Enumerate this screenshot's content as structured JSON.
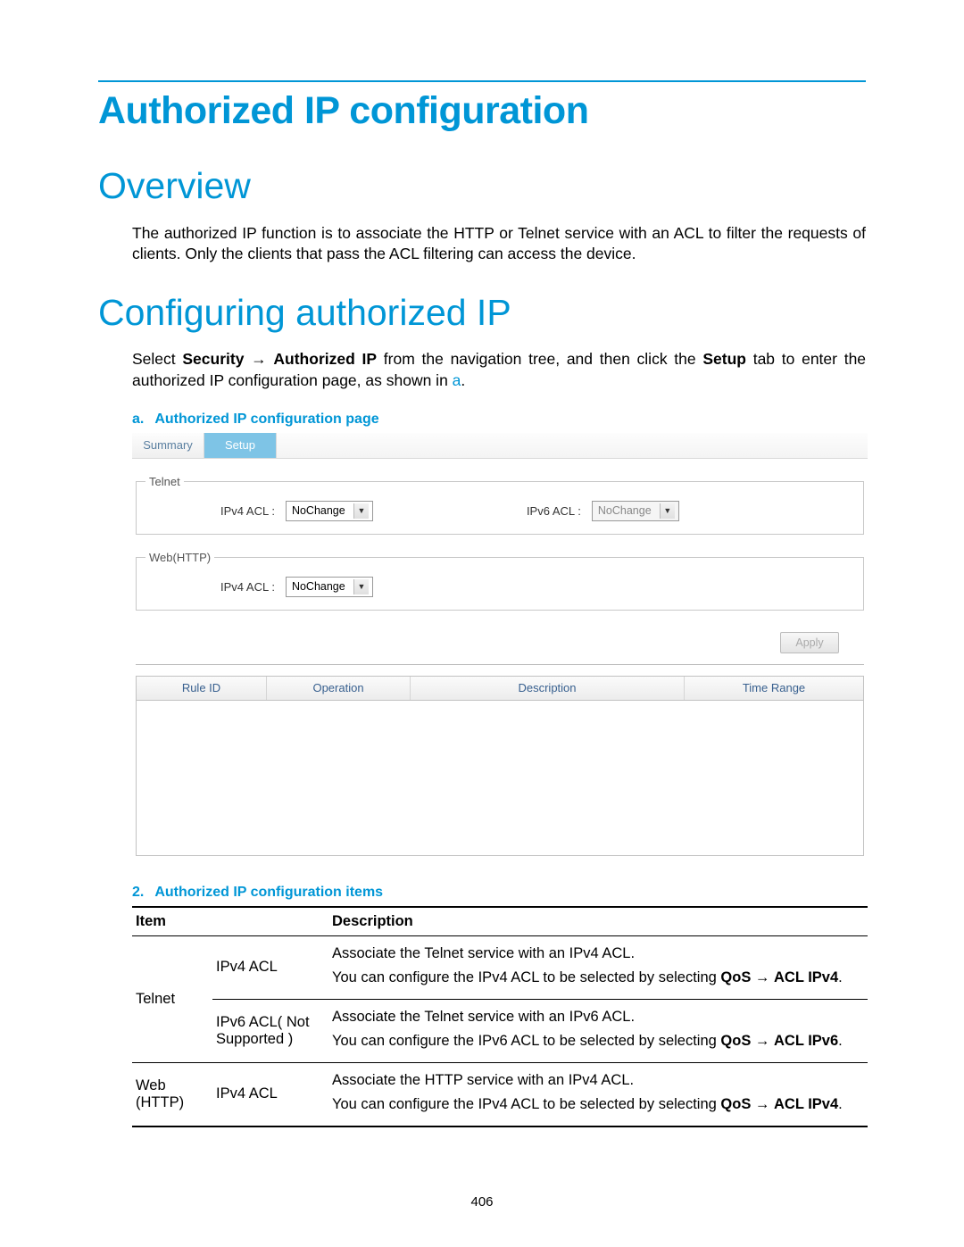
{
  "title": "Authorized IP configuration",
  "sections": {
    "overview": {
      "heading": "Overview",
      "para": "The authorized IP function is to associate the HTTP or Telnet service with an ACL to filter the requests of clients. Only the clients that pass the ACL filtering can access the device."
    },
    "configuring": {
      "heading": "Configuring authorized IP",
      "para_pre": "Select ",
      "nav1": "Security",
      "arrow": " → ",
      "nav2": "Authorized IP",
      "para_mid1": " from the navigation tree, and then click the ",
      "nav3": "Setup",
      "para_mid2": " tab to enter the authorized IP configuration page, as shown in ",
      "ref": "a",
      "para_end": "."
    }
  },
  "figure": {
    "caption_idx": "a.",
    "caption_text": "Authorized IP configuration page",
    "tabs": {
      "inactive": "Summary",
      "active": "Setup"
    },
    "telnet": {
      "legend": "Telnet",
      "ipv4_label": "IPv4 ACL :",
      "ipv4_sel": "NoChange",
      "ipv6_label": "IPv6 ACL :",
      "ipv6_sel": "NoChange"
    },
    "web": {
      "legend": "Web(HTTP)",
      "ipv4_label": "IPv4 ACL :",
      "ipv4_sel": "NoChange"
    },
    "apply": "Apply",
    "grid": {
      "c1": "Rule ID",
      "c2": "Operation",
      "c3": "Description",
      "c4": "Time Range"
    }
  },
  "items_caption": {
    "idx": "2.",
    "text": "Authorized IP configuration items"
  },
  "table": {
    "headers": {
      "item": "Item",
      "desc": "Description"
    },
    "rows": [
      {
        "cat": "Telnet",
        "sub": "IPv4 ACL",
        "d1": "Associate the Telnet service with an IPv4 ACL.",
        "d2_pre": "You can configure the IPv4 ACL to be selected by selecting ",
        "d2_b1": "QoS",
        "d2_arrow": " → ",
        "d2_b2": "ACL IPv4",
        "d2_end": "."
      },
      {
        "cat": "",
        "sub": "IPv6 ACL( Not Supported )",
        "d1": "Associate the Telnet service with an IPv6 ACL.",
        "d2_pre": "You can configure the IPv6 ACL to be selected by selecting ",
        "d2_b1": "QoS",
        "d2_arrow": " → ",
        "d2_b2": "ACL IPv6",
        "d2_end": "."
      },
      {
        "cat": "Web (HTTP)",
        "sub": "IPv4 ACL",
        "d1": "Associate the HTTP service with an IPv4 ACL.",
        "d2_pre": "You can configure the IPv4 ACL to be selected by selecting ",
        "d2_b1": "QoS",
        "d2_arrow": " → ",
        "d2_b2": "ACL IPv4",
        "d2_end": "."
      }
    ]
  },
  "page_number": "406"
}
